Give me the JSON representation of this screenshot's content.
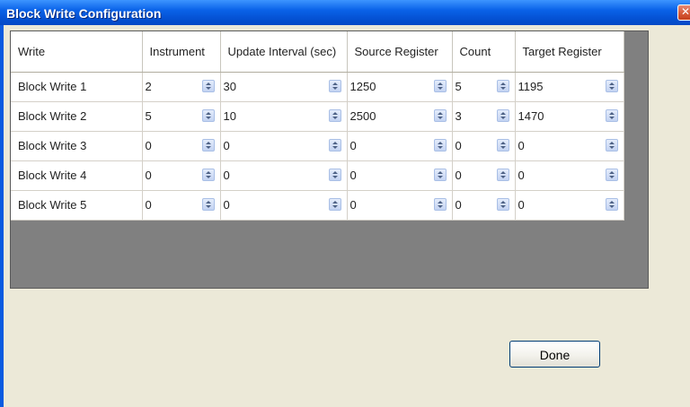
{
  "window": {
    "title": "Block Write Configuration",
    "close_glyph": "✕"
  },
  "grid": {
    "headers": [
      "Write",
      "Instrument",
      "Update Interval (sec)",
      "Source Register",
      "Count",
      "Target Register"
    ],
    "rows": [
      {
        "label": "Block Write 1",
        "values": [
          "2",
          "30",
          "1250",
          "5",
          "1195"
        ]
      },
      {
        "label": "Block Write 2",
        "values": [
          "5",
          "10",
          "2500",
          "3",
          "1470"
        ]
      },
      {
        "label": "Block Write 3",
        "values": [
          "0",
          "0",
          "0",
          "0",
          "0"
        ]
      },
      {
        "label": "Block Write 4",
        "values": [
          "0",
          "0",
          "0",
          "0",
          "0"
        ]
      },
      {
        "label": "Block Write 5",
        "values": [
          "0",
          "0",
          "0",
          "0",
          "0"
        ]
      }
    ]
  },
  "buttons": {
    "done": "Done"
  }
}
